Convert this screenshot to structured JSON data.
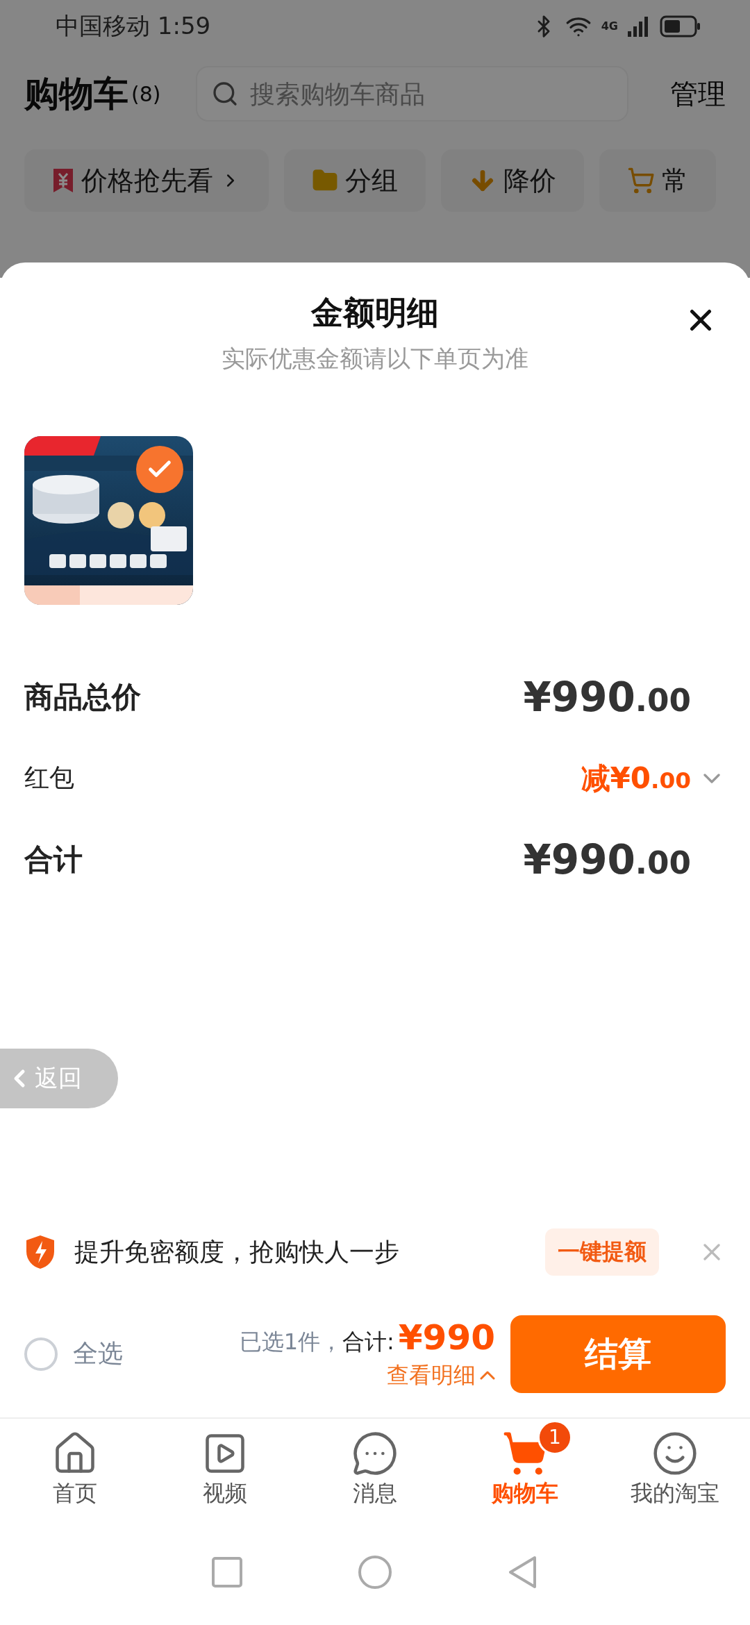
{
  "status_bar": {
    "carrier": "中国移动",
    "time": "1:59",
    "network": "4G"
  },
  "header": {
    "title": "购物车",
    "count": "(8)",
    "search": {
      "placeholder": "搜索购物车商品"
    },
    "manage": "管理"
  },
  "filters": [
    {
      "label": "价格抢先看",
      "kind": "price",
      "chevron": true
    },
    {
      "label": "分组",
      "kind": "folder",
      "chevron": false
    },
    {
      "label": "降价",
      "kind": "drop",
      "chevron": false
    },
    {
      "label": "常",
      "kind": "cart",
      "chevron": false
    }
  ],
  "sheet": {
    "title": "金额明细",
    "subtitle": "实际优惠金额请以下单页为准",
    "items": [
      {
        "kind": "picture",
        "checked": true
      }
    ],
    "rows": [
      {
        "label": "商品总价",
        "value": "¥990.00",
        "kind": "total"
      },
      {
        "label": "红包",
        "value": "减¥0.00",
        "kind": "discount"
      },
      {
        "label": "合计",
        "value": "¥990.00",
        "kind": "total"
      }
    ]
  },
  "back_button": {
    "label": "返回"
  },
  "promo": {
    "text": "提升免密额度，抢购快人一步",
    "action": "一键提额"
  },
  "checkout": {
    "select_all": {
      "label": "全选",
      "checked": false
    },
    "summary": "已选1件，",
    "total_label": "合计:",
    "total": "¥990",
    "details": "查看明细",
    "button": "结算"
  },
  "tabs": [
    {
      "label": "首页",
      "kind": "home",
      "selected": false
    },
    {
      "label": "视频",
      "kind": "video",
      "selected": false
    },
    {
      "label": "消息",
      "kind": "message",
      "selected": false
    },
    {
      "label": "购物车",
      "kind": "cart",
      "selected": true,
      "badge": "1"
    },
    {
      "label": "我的淘宝",
      "kind": "profile",
      "selected": false
    }
  ]
}
